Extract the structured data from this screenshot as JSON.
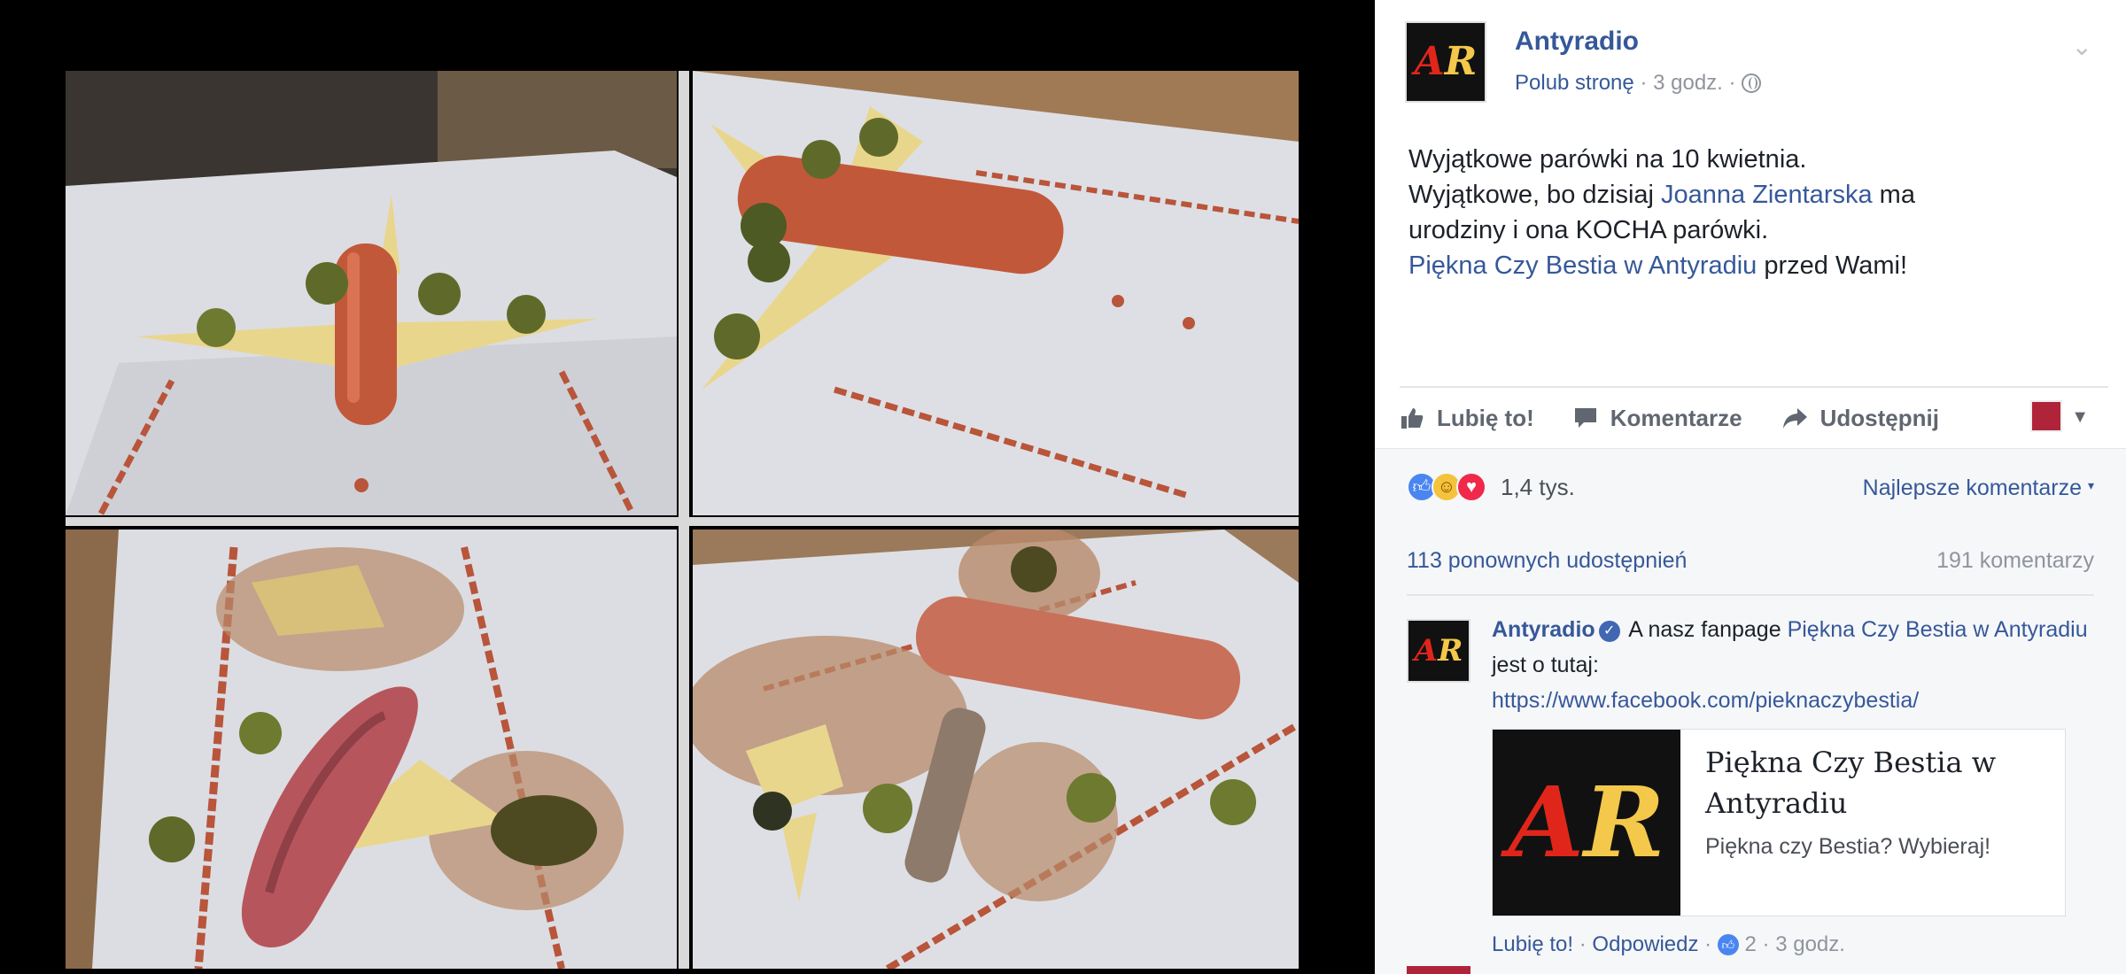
{
  "page": {
    "name": "Antyradio",
    "like_page": "Polub stronę",
    "time": "3 godz.",
    "logo_a": "A",
    "logo_r": "R"
  },
  "post": {
    "line1": "Wyjątkowe parówki na 10 kwietnia.",
    "line2_pre": "Wyjątkowe, bo dzisiaj ",
    "line2_link": "Joanna Zientarska",
    "line2_post": " ma",
    "line3": "urodziny i ona KOCHA parówki.",
    "line4_link": "Piękna Czy Bestia w Antyradiu",
    "line4_post": " przed Wami!"
  },
  "actions": {
    "like": "Lubię to!",
    "comment": "Komentarze",
    "share": "Udostępnij"
  },
  "stats": {
    "reactions_count": "1,4 tys.",
    "best_comments": "Najlepsze komentarze",
    "shares": "113 ponownych udostępnień",
    "comments": "191 komentarzy"
  },
  "comment": {
    "author": "Antyradio",
    "text_pre": " A nasz fanpage ",
    "text_link": "Piękna Czy Bestia w Antyradiu",
    "text_post": " jest o tutaj:",
    "url": "https://www.facebook.com/pieknaczybestia/",
    "preview_title": "Piękna Czy Bestia w Antyradiu",
    "preview_desc": "Piękna czy Bestia? Wybieraj!",
    "meta_like": "Lubię to!",
    "meta_reply": "Odpowiedz",
    "meta_likes": "2",
    "meta_time": "3 godz."
  },
  "colors": {
    "link": "#365899",
    "meta": "#90949c",
    "logo_red": "#e0261b",
    "logo_yellow": "#f4c84a"
  }
}
